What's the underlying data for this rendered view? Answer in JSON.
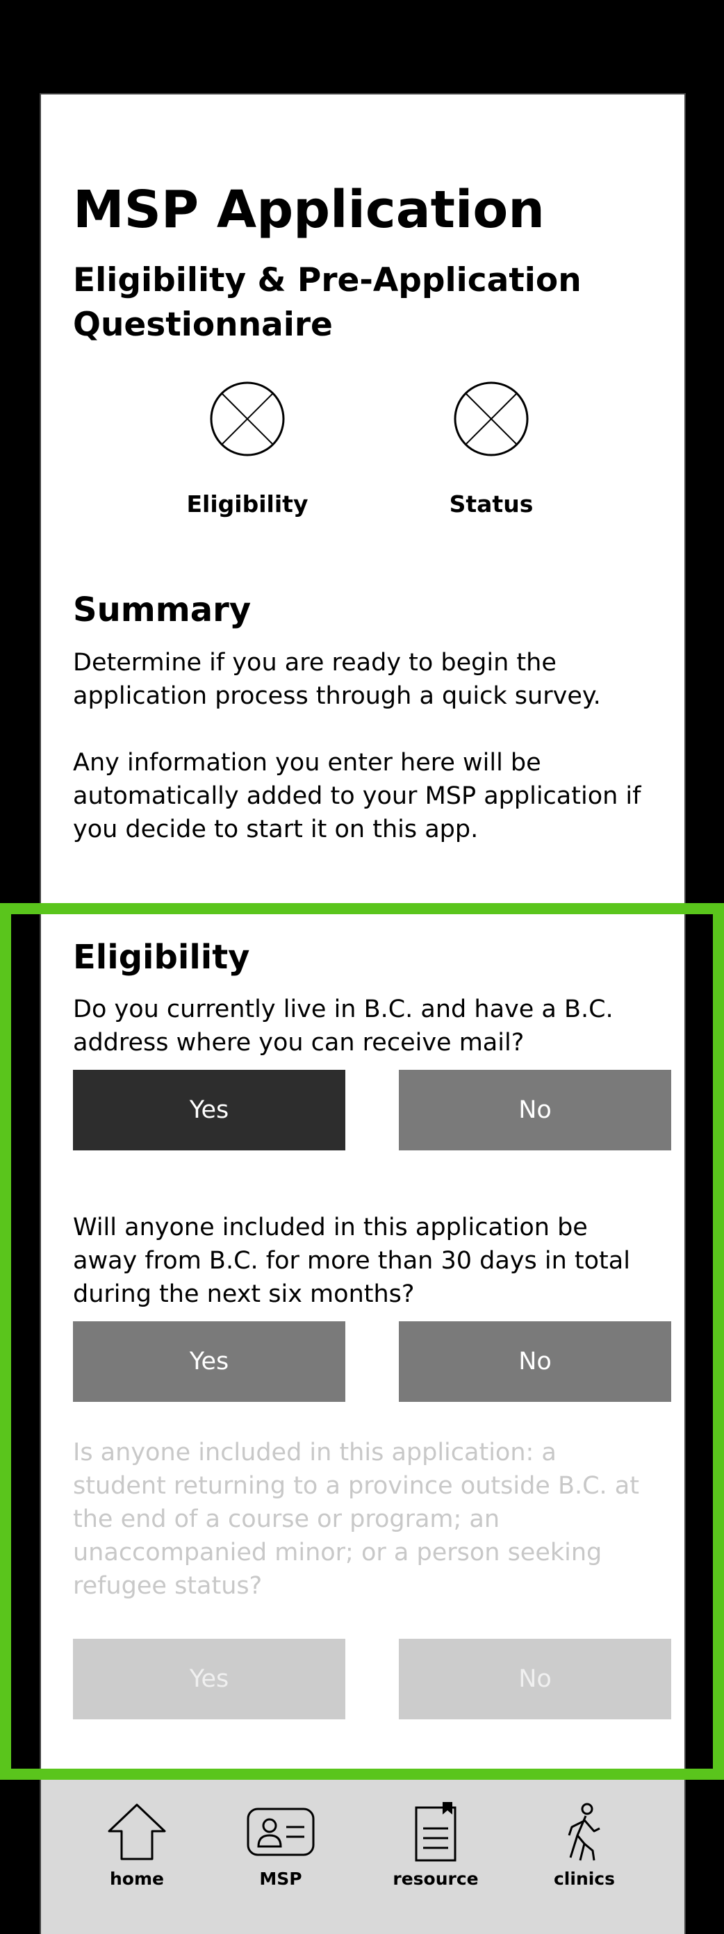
{
  "header": {
    "title": "MSP Application",
    "subtitle": "Eligibility & Pre-Application Questionnaire"
  },
  "steps": [
    {
      "label": "Eligibility",
      "icon": "x-circle-icon"
    },
    {
      "label": "Status",
      "icon": "x-circle-icon"
    }
  ],
  "summary": {
    "heading": "Summary",
    "paragraph1": "Determine if you are ready to begin the application process through a quick survey.",
    "paragraph2": "Any information you enter here will be automatically added to your MSP application if you decide to start it on this app."
  },
  "eligibility": {
    "heading": "Eligibility",
    "questions": [
      {
        "text": "Do you currently live in B.C. and have a B.C. address where you can receive mail?",
        "yes": "Yes",
        "no": "No",
        "selected": "Yes",
        "enabled": true
      },
      {
        "text": "Will anyone included in this application be away from B.C. for more than 30 days in total during the next six months?",
        "yes": "Yes",
        "no": "No",
        "selected": null,
        "enabled": true
      },
      {
        "text": "Is anyone included in this application: a student returning to a  province outside B.C. at the end of a course or program; an unaccompanied minor; or a person seeking refugee status?",
        "yes": "Yes",
        "no": "No",
        "selected": null,
        "enabled": false
      }
    ]
  },
  "nav": {
    "items": [
      {
        "label": "home",
        "icon": "home-icon"
      },
      {
        "label": "MSP",
        "icon": "id-card-icon"
      },
      {
        "label": "resource",
        "icon": "document-icon"
      },
      {
        "label": "clinics",
        "icon": "walking-person-icon"
      }
    ]
  },
  "colors": {
    "highlight": "#5ac51c",
    "button_selected": "#2d2d2d",
    "button_default": "#7a7a7a",
    "button_disabled": "#cccccc",
    "nav_background": "#d9d9d9"
  }
}
